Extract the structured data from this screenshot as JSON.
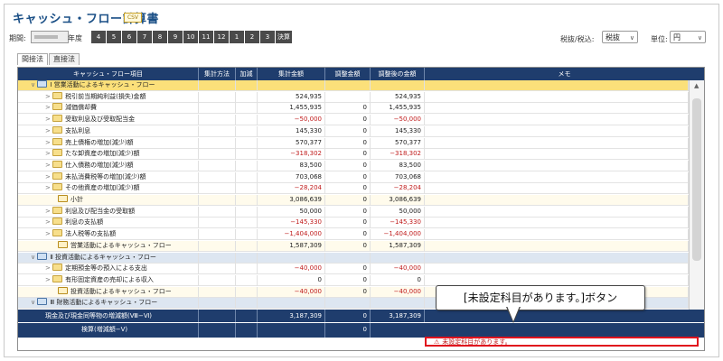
{
  "header": {
    "title": "キャッシュ・フロー計算書",
    "csv_icon": "CSV",
    "period_label": "期間:",
    "period_year_suffix": "年度",
    "months": [
      "4",
      "5",
      "6",
      "7",
      "8",
      "9",
      "10",
      "11",
      "12",
      "1",
      "2",
      "3",
      "決算"
    ]
  },
  "controls": {
    "tax_label": "税抜/税込:",
    "tax_value": "税抜",
    "unit_label": "単位:",
    "unit_value": "円"
  },
  "tabs": [
    "間接法",
    "直接法"
  ],
  "columns": [
    "キャッシュ・フロー項目",
    "集計方法",
    "加減",
    "集計金額",
    "調整金額",
    "調整後の金額",
    "メモ"
  ],
  "rows": [
    {
      "kind": "section-active",
      "label": "Ⅰ 営業活動によるキャッシュ・フロー",
      "sum": "",
      "adj": "",
      "after": ""
    },
    {
      "kind": "item",
      "label": "税引前当期純利益(損失)金額",
      "sum": "524,935",
      "adj": "",
      "after": "524,935"
    },
    {
      "kind": "item",
      "label": "減価償却費",
      "sum": "1,455,935",
      "adj": "0",
      "after": "1,455,935"
    },
    {
      "kind": "item",
      "label": "受取利息及び受取配当金",
      "sum": "−50,000",
      "adj": "0",
      "after": "−50,000"
    },
    {
      "kind": "item",
      "label": "支払利息",
      "sum": "145,330",
      "adj": "0",
      "after": "145,330"
    },
    {
      "kind": "item",
      "label": "売上債権の増加(減少)額",
      "sum": "570,377",
      "adj": "0",
      "after": "570,377"
    },
    {
      "kind": "item",
      "label": "たな卸資産の増加(減少)額",
      "sum": "−318,302",
      "adj": "0",
      "after": "−318,302"
    },
    {
      "kind": "item",
      "label": "仕入債務の増加(減少)額",
      "sum": "83,500",
      "adj": "0",
      "after": "83,500"
    },
    {
      "kind": "item",
      "label": "未払消費税等の増加(減少)額",
      "sum": "703,068",
      "adj": "0",
      "after": "703,068"
    },
    {
      "kind": "item",
      "label": "その他資産の増加(減少)額",
      "sum": "−28,204",
      "adj": "0",
      "after": "−28,204"
    },
    {
      "kind": "sub",
      "label": "小計",
      "sum": "3,086,639",
      "adj": "0",
      "after": "3,086,639"
    },
    {
      "kind": "item",
      "label": "利息及び配当金の受取額",
      "sum": "50,000",
      "adj": "0",
      "after": "50,000"
    },
    {
      "kind": "item",
      "label": "利息の支払額",
      "sum": "−145,330",
      "adj": "0",
      "after": "−145,330"
    },
    {
      "kind": "item",
      "label": "法人税等の支払額",
      "sum": "−1,404,000",
      "adj": "0",
      "after": "−1,404,000"
    },
    {
      "kind": "sub",
      "label": "営業活動によるキャッシュ・フロー",
      "sum": "1,587,309",
      "adj": "0",
      "after": "1,587,309"
    },
    {
      "kind": "section",
      "label": "Ⅱ 投資活動によるキャッシュ・フロー",
      "sum": "",
      "adj": "",
      "after": ""
    },
    {
      "kind": "item",
      "label": "定期預金等の預入による支出",
      "sum": "−40,000",
      "adj": "0",
      "after": "−40,000"
    },
    {
      "kind": "item",
      "label": "有形固定資産の売却による収入",
      "sum": "0",
      "adj": "0",
      "after": "0"
    },
    {
      "kind": "sub",
      "label": "投資活動によるキャッシュ・フロー",
      "sum": "−40,000",
      "adj": "0",
      "after": "−40,000"
    },
    {
      "kind": "section",
      "label": "Ⅲ 財務活動によるキャッシュ・フロー",
      "sum": "",
      "adj": "",
      "after": ""
    }
  ],
  "footer": {
    "total_label": "現金及び現金同等物の増減額(Ⅷ−Ⅵ)",
    "total_sum": "3,187,309",
    "total_adj": "0",
    "total_after": "3,187,309",
    "check_label": "検算(増減額−Ⅴ)",
    "check_adj": "0"
  },
  "warning_button": "未設定科目があります。",
  "callout": "[未設定科目があります。]ボタン"
}
